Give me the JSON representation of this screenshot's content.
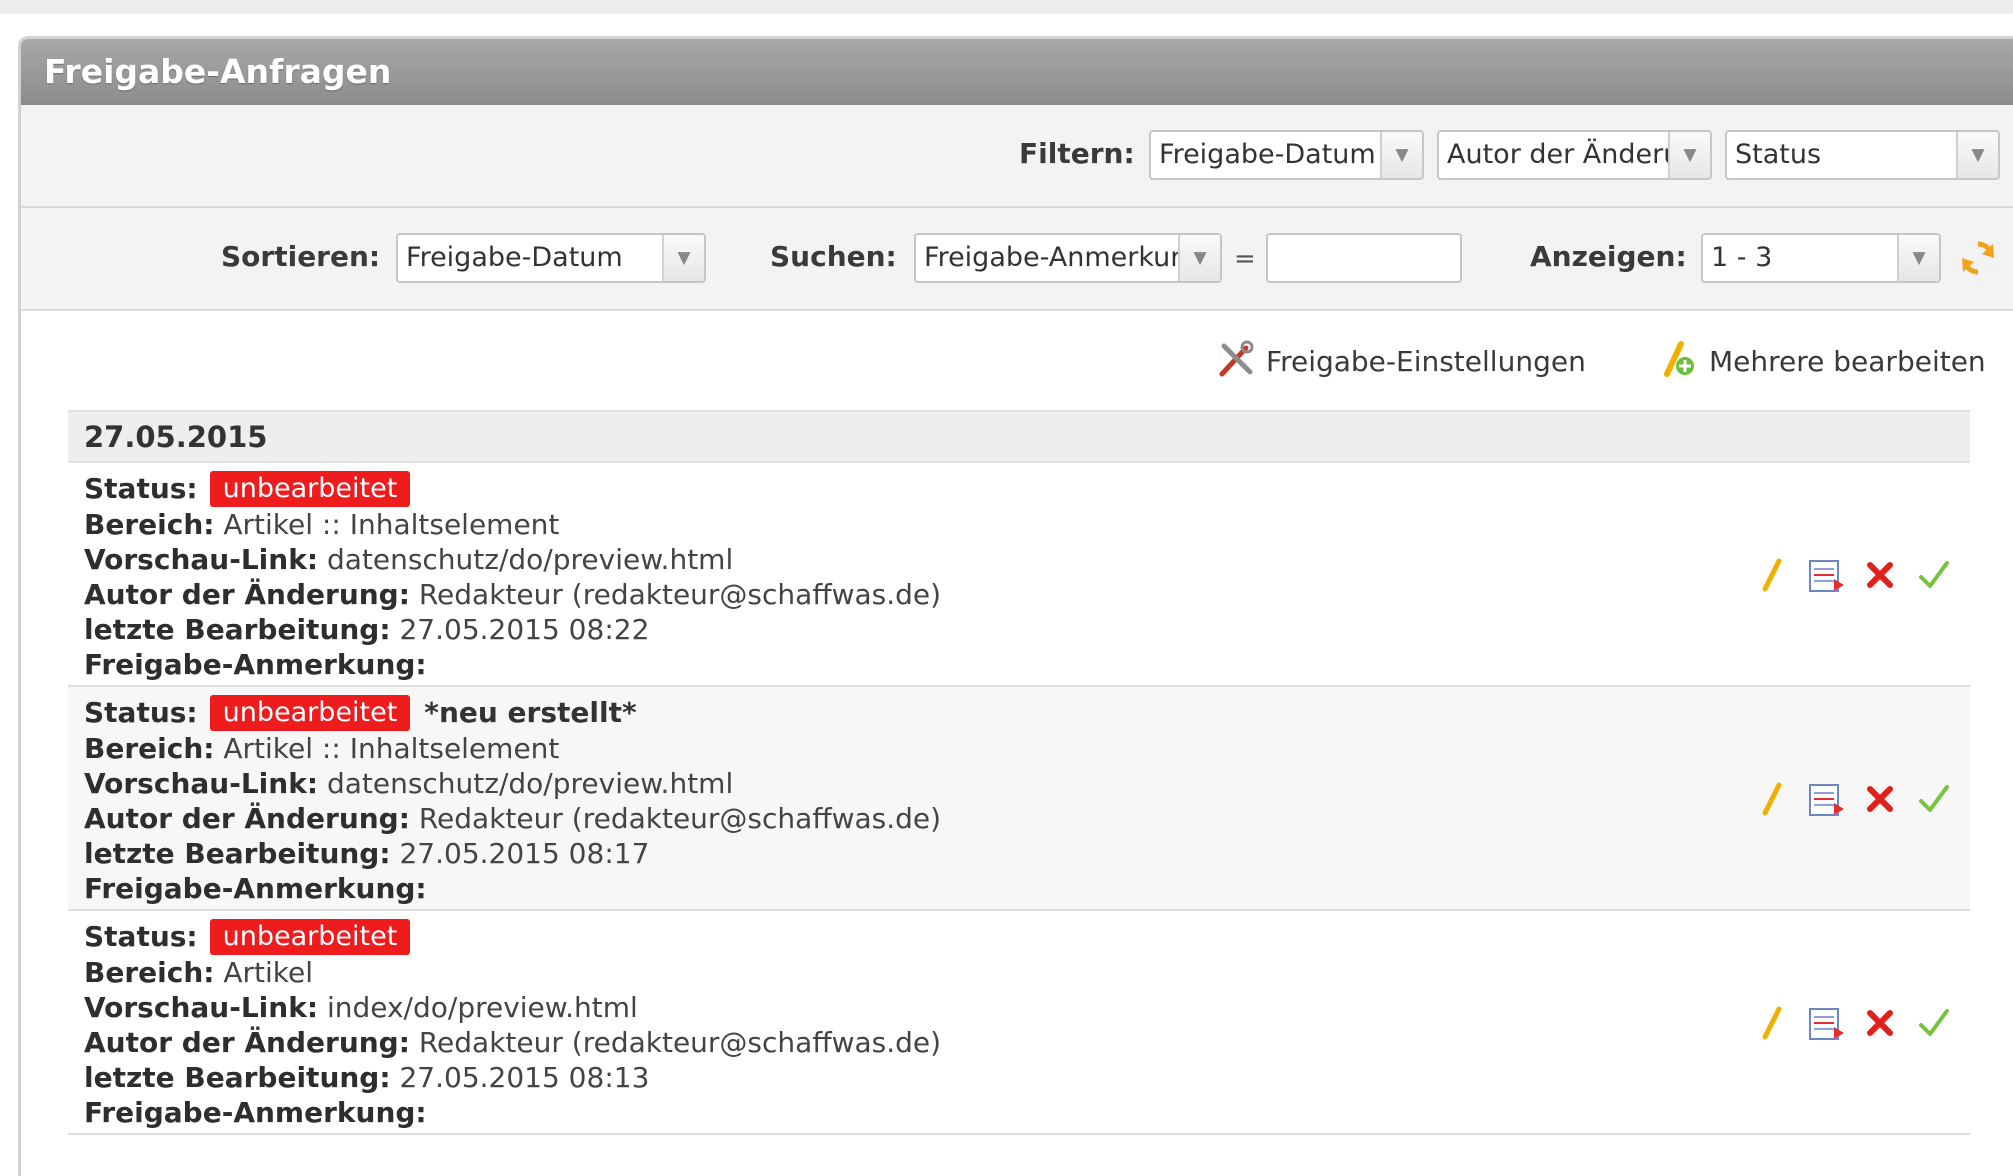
{
  "header": {
    "title": "Freigabe-Anfragen"
  },
  "filter": {
    "label": "Filtern:",
    "selects": [
      "Freigabe-Datum",
      "Autor der Änderung",
      "Status"
    ]
  },
  "sort": {
    "sort_label": "Sortieren:",
    "sort_value": "Freigabe-Datum",
    "search_label": "Suchen:",
    "search_field": "Freigabe-Anmerkung",
    "equals": "=",
    "search_value": "",
    "show_label": "Anzeigen:",
    "show_value": "1 - 3"
  },
  "actions": {
    "settings": "Freigabe-Einstellungen",
    "multi_edit": "Mehrere bearbeiten"
  },
  "labels": {
    "status": "Status:",
    "bereich": "Bereich:",
    "vorschau": "Vorschau-Link:",
    "autor": "Autor der Änderung:",
    "letzte": "letzte Bearbeitung:",
    "anmerkung": "Freigabe-Anmerkung:"
  },
  "group": {
    "date": "27.05.2015",
    "entries": [
      {
        "status": "unbearbeitet",
        "tag": "",
        "bereich": "Artikel :: Inhaltselement",
        "vorschau": "datenschutz/do/preview.html",
        "autor": "Redakteur (redakteur@schaffwas.de)",
        "letzte": "27.05.2015 08:22",
        "anmerkung": ""
      },
      {
        "status": "unbearbeitet",
        "tag": "*neu erstellt*",
        "bereich": "Artikel :: Inhaltselement",
        "vorschau": "datenschutz/do/preview.html",
        "autor": "Redakteur (redakteur@schaffwas.de)",
        "letzte": "27.05.2015 08:17",
        "anmerkung": ""
      },
      {
        "status": "unbearbeitet",
        "tag": "",
        "bereich": "Artikel",
        "vorschau": "index/do/preview.html",
        "autor": "Redakteur (redakteur@schaffwas.de)",
        "letzte": "27.05.2015 08:13",
        "anmerkung": ""
      }
    ]
  },
  "colors": {
    "status_badge": "#ee1c1c",
    "titlebar": "#999999",
    "accept": "#7cc242",
    "reject": "#e0201b"
  },
  "icons": [
    "refresh-icon",
    "tools-icon",
    "edit-multiple-icon",
    "pencil-icon",
    "diff-icon",
    "reject-icon",
    "accept-icon"
  ]
}
